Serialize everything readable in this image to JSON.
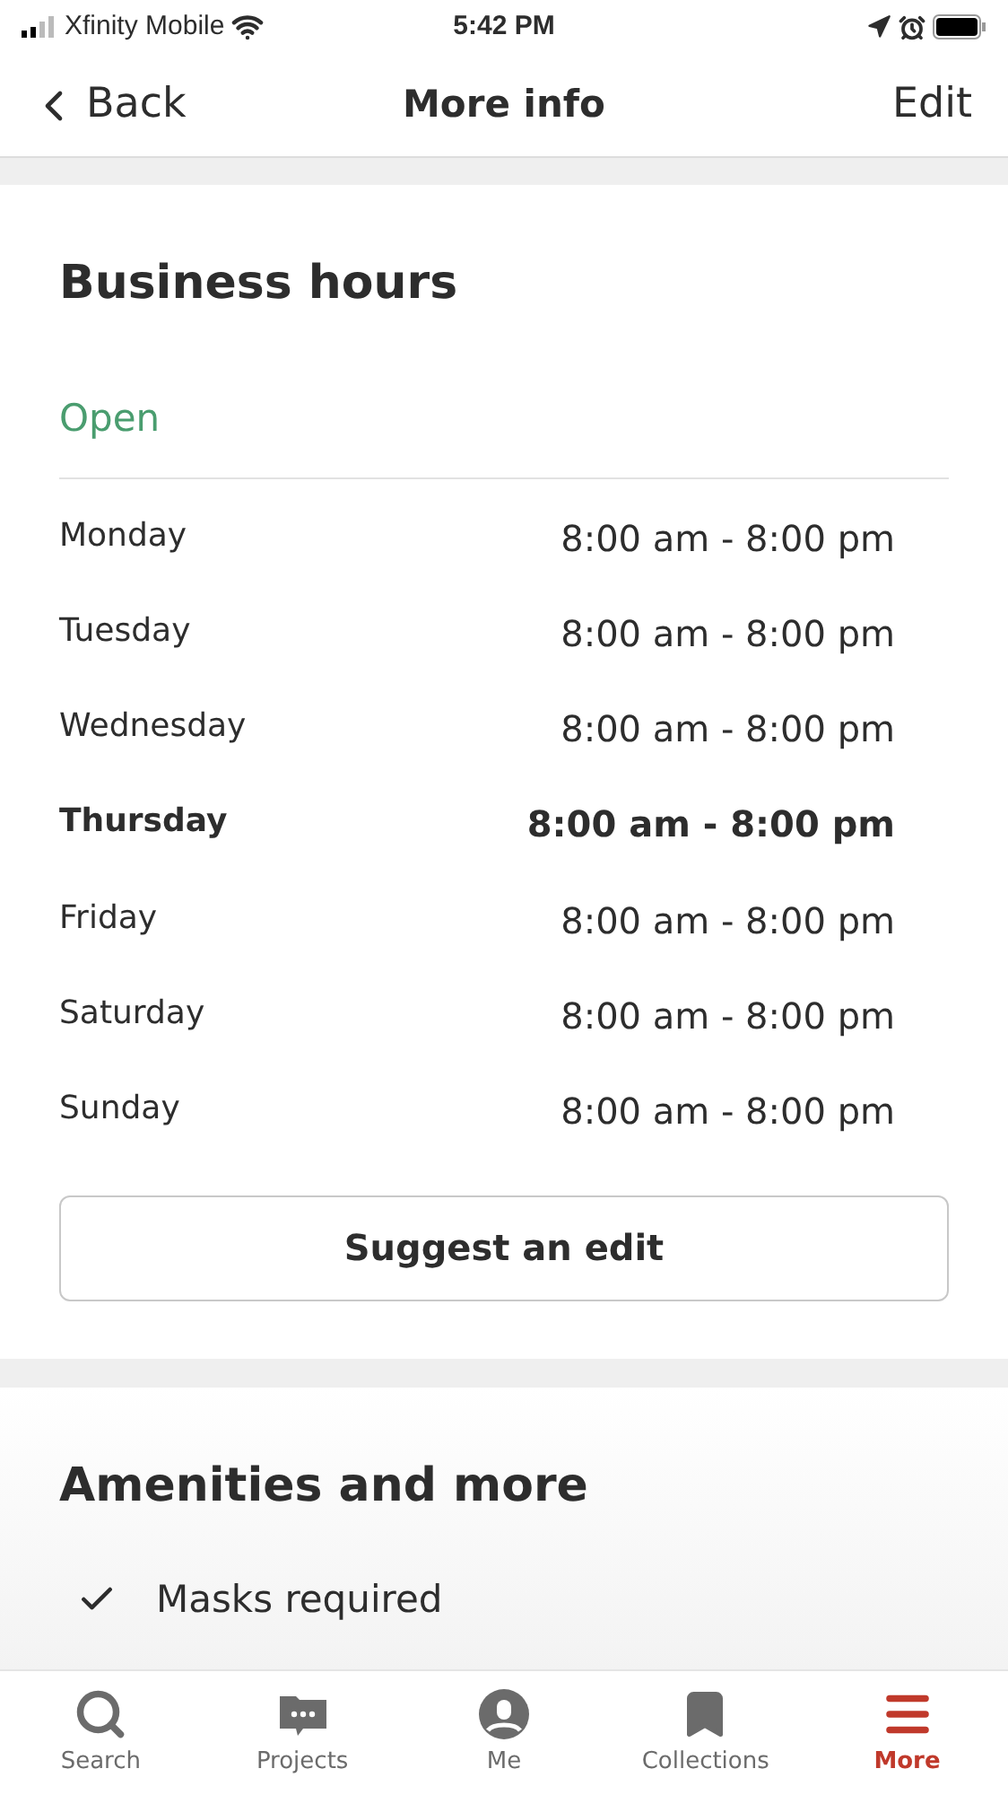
{
  "status_bar": {
    "carrier": "Xfinity Mobile",
    "time": "5:42 PM"
  },
  "nav": {
    "back": "Back",
    "title": "More info",
    "action": "Edit"
  },
  "business_hours": {
    "title": "Business hours",
    "status": "Open",
    "open": true,
    "days": [
      {
        "day": "Monday",
        "hours": "8:00 am - 8:00 pm",
        "today": false
      },
      {
        "day": "Tuesday",
        "hours": "8:00 am - 8:00 pm",
        "today": false
      },
      {
        "day": "Wednesday",
        "hours": "8:00 am - 8:00 pm",
        "today": false
      },
      {
        "day": "Thursday",
        "hours": "8:00 am - 8:00 pm",
        "today": true
      },
      {
        "day": "Friday",
        "hours": "8:00 am - 8:00 pm",
        "today": false
      },
      {
        "day": "Saturday",
        "hours": "8:00 am - 8:00 pm",
        "today": false
      },
      {
        "day": "Sunday",
        "hours": "8:00 am - 8:00 pm",
        "today": false
      }
    ],
    "button": "Suggest an edit"
  },
  "amenities": {
    "title": "Amenities and more",
    "items": [
      {
        "label": "Masks required",
        "checked": true
      }
    ]
  },
  "tab_bar": [
    {
      "kind": "search",
      "label": "Search",
      "selected": false
    },
    {
      "kind": "projects",
      "label": "Projects",
      "selected": false
    },
    {
      "kind": "me",
      "label": "Me",
      "selected": false
    },
    {
      "kind": "collections",
      "label": "Collections",
      "selected": false
    },
    {
      "kind": "more",
      "label": "More",
      "selected": true
    }
  ]
}
